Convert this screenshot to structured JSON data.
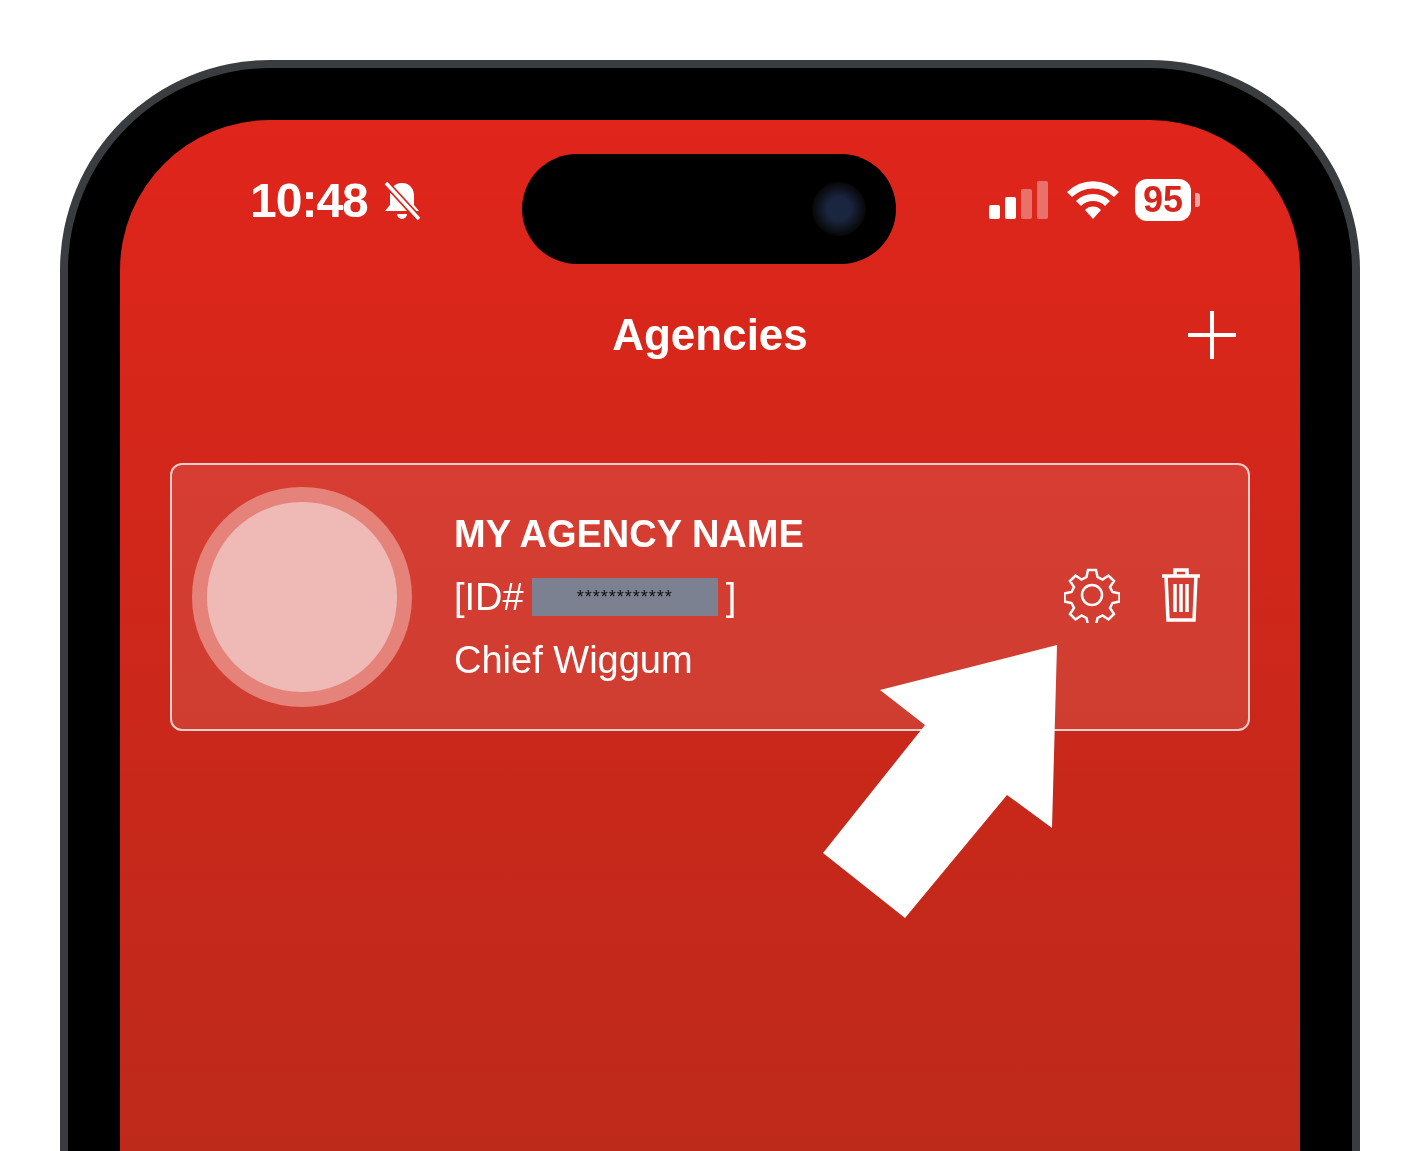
{
  "status_bar": {
    "time": "10:48",
    "battery": "95"
  },
  "nav": {
    "title": "Agencies"
  },
  "agencies": [
    {
      "name": "MY AGENCY NAME",
      "id_prefix": "[ID#",
      "id_value": "************",
      "id_suffix": "]",
      "contact": "Chief Wiggum"
    }
  ]
}
